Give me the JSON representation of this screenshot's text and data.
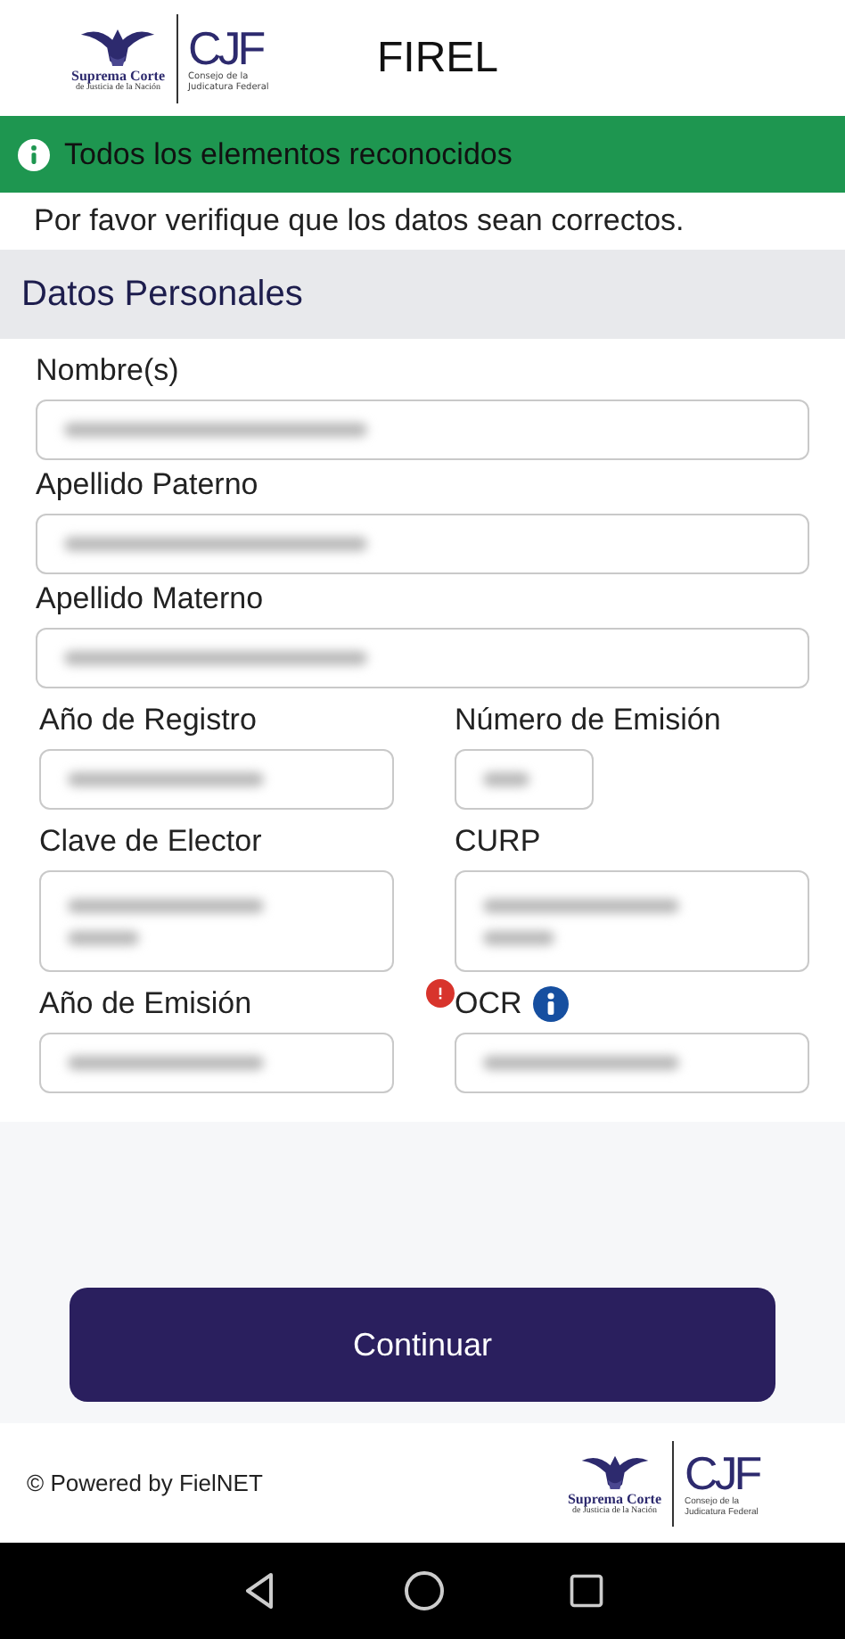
{
  "header": {
    "title": "FIREL",
    "logo": {
      "scjn_name": "Suprema Corte",
      "scjn_sub": "de Justicia de la Nación",
      "cjf_mark": "CJF",
      "cjf_sub": "Consejo de la Judicatura Federal"
    }
  },
  "banner": {
    "text": "Todos los elementos reconocidos"
  },
  "instruction": "Por favor verifique que los datos sean correctos.",
  "section": {
    "title": "Datos Personales"
  },
  "fields": [
    {
      "label": "Nombre(s)",
      "kind": "full",
      "multiline": false,
      "redacted": true,
      "error": false,
      "info": false
    },
    {
      "label": "Apellido Paterno",
      "kind": "full",
      "multiline": false,
      "redacted": true,
      "error": false,
      "info": false
    },
    {
      "label": "Apellido Materno",
      "kind": "full",
      "multiline": false,
      "redacted": true,
      "error": false,
      "info": false
    },
    {
      "label": "Año de Registro",
      "kind": "half",
      "multiline": false,
      "redacted": true,
      "error": false,
      "info": false
    },
    {
      "label": "Número de Emisión",
      "kind": "short",
      "multiline": false,
      "redacted": true,
      "error": false,
      "info": false
    },
    {
      "label": "Clave de Elector",
      "kind": "half",
      "multiline": true,
      "redacted": true,
      "error": false,
      "info": false
    },
    {
      "label": "CURP",
      "kind": "half",
      "multiline": true,
      "redacted": true,
      "error": false,
      "info": false
    },
    {
      "label": "Año de Emisión",
      "kind": "half",
      "multiline": false,
      "redacted": true,
      "error": false,
      "info": false
    },
    {
      "label": "OCR",
      "kind": "half",
      "multiline": false,
      "redacted": true,
      "error": true,
      "info": true
    }
  ],
  "button": "Continuar",
  "footer": {
    "text": "© Powered by FielNET",
    "logo": {
      "scjn_name": "Suprema Corte",
      "scjn_sub": "de Justicia de la Nación",
      "cjf_mark": "CJF",
      "cjf_sub": "Consejo de la Judicatura Federal"
    }
  }
}
